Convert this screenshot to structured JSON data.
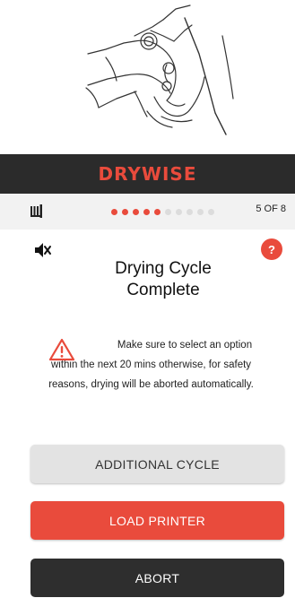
{
  "header": {
    "brand": "DRYWISE"
  },
  "progress": {
    "step_label": "5 OF 8",
    "total_steps": 10,
    "completed_steps": 5
  },
  "screen": {
    "title": "Drying Cycle Complete",
    "warning_lines": [
      "Make sure to select an option",
      "within the next 20 mins otherwise, for safety",
      "reasons, drying will be aborted automatically."
    ],
    "help_label": "?"
  },
  "actions": {
    "additional_cycle": "ADDITIONAL CYCLE",
    "load_printer": "LOAD PRINTER",
    "abort": "ABORT"
  },
  "icons": {
    "mute": "speaker-muted-icon",
    "warning": "warning-triangle-icon",
    "device": "filament-device-icon",
    "illustration": "hand-cutting-filament-illustration"
  },
  "colors": {
    "accent": "#e94b3c",
    "dark": "#2b2b2b",
    "neutral_button": "#e3e3e3"
  }
}
